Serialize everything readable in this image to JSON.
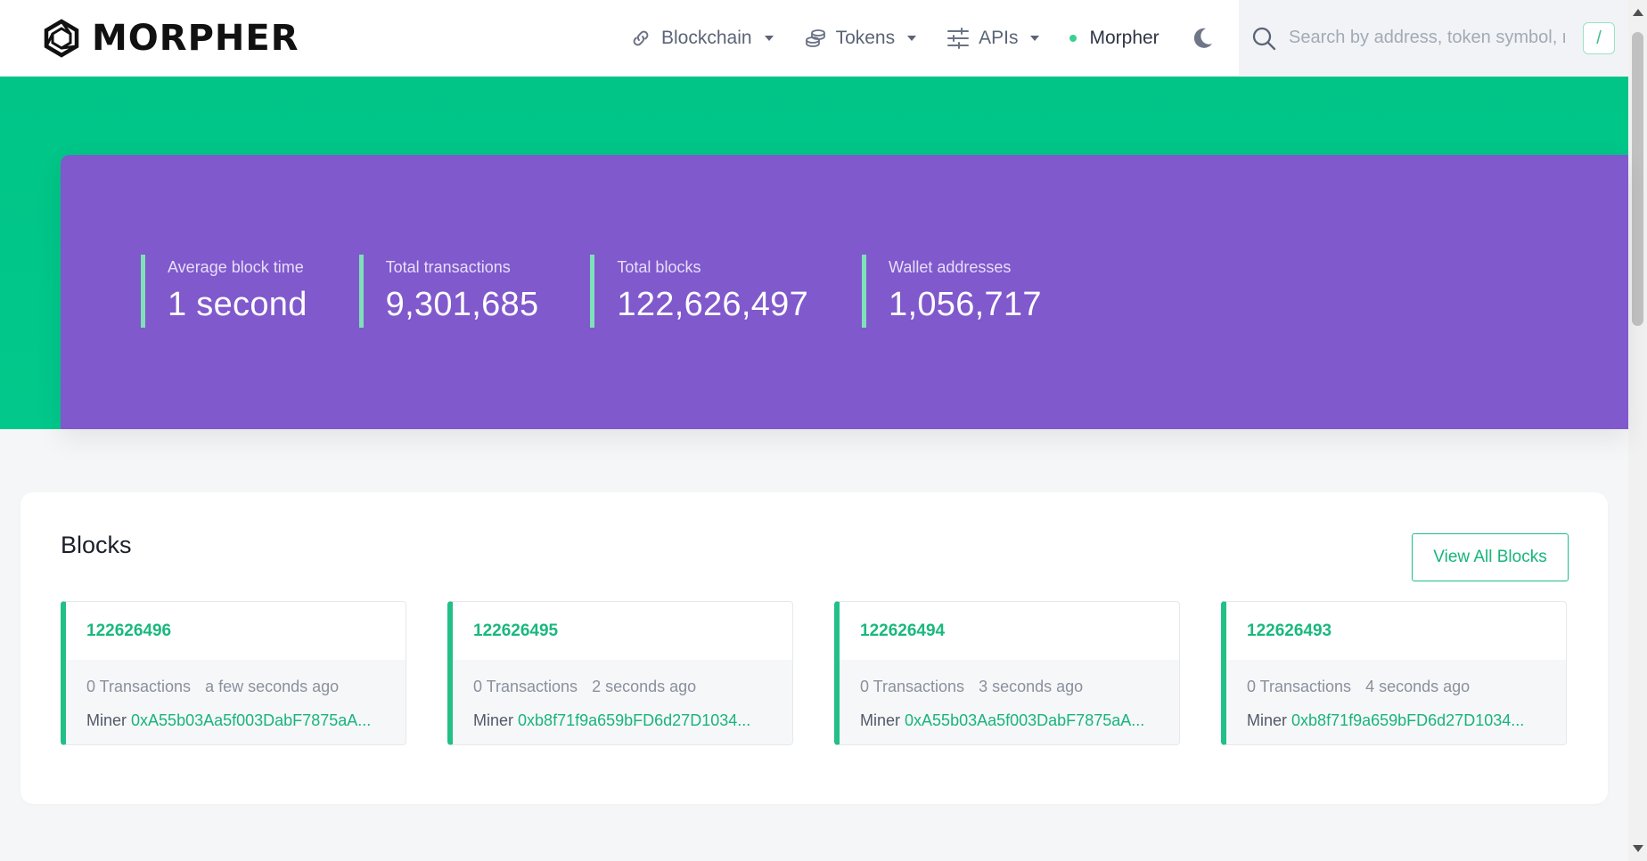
{
  "header": {
    "logo_text": "MORPHER",
    "nav": [
      {
        "label": "Blockchain",
        "icon": "link-icon"
      },
      {
        "label": "Tokens",
        "icon": "coins-icon"
      },
      {
        "label": "APIs",
        "icon": "sliders-icon"
      }
    ],
    "network_label": "Morpher",
    "search_placeholder": "Search by address, token symbol, name",
    "search_shortcut": "/"
  },
  "stats": [
    {
      "label": "Average block time",
      "value": "1 second"
    },
    {
      "label": "Total transactions",
      "value": "9,301,685"
    },
    {
      "label": "Total blocks",
      "value": "122,626,497"
    },
    {
      "label": "Wallet addresses",
      "value": "1,056,717"
    }
  ],
  "blocks": {
    "title": "Blocks",
    "view_all_label": "View All Blocks",
    "miner_label": "Miner",
    "items": [
      {
        "number": "122626496",
        "transactions": "0 Transactions",
        "time": "a few seconds ago",
        "miner": "0xA55b03Aa5f003DabF7875aA..."
      },
      {
        "number": "122626495",
        "transactions": "0 Transactions",
        "time": "2 seconds ago",
        "miner": "0xb8f71f9a659bFD6d27D1034..."
      },
      {
        "number": "122626494",
        "transactions": "0 Transactions",
        "time": "3 seconds ago",
        "miner": "0xA55b03Aa5f003DabF7875aA..."
      },
      {
        "number": "122626493",
        "transactions": "0 Transactions",
        "time": "4 seconds ago",
        "miner": "0xb8f71f9a659bFD6d27D1034..."
      }
    ]
  },
  "colors": {
    "brand_green": "#00c587",
    "hero_purple": "#8059cc",
    "accent_text_green": "#18b47b"
  }
}
